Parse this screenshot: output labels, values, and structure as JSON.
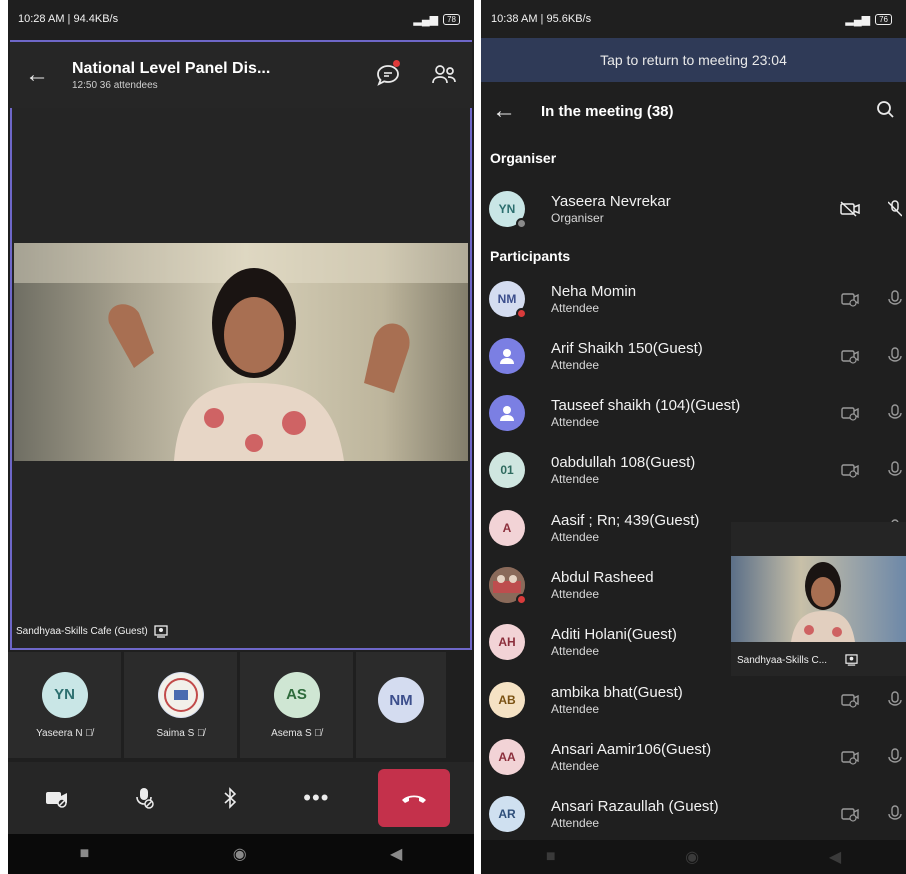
{
  "left": {
    "status": {
      "time_speed": "10:28 AM | 94.4KB/s",
      "battery": "78"
    },
    "header": {
      "title": "National Level Panel Dis...",
      "subtitle": "12:50  36 attendees"
    },
    "speaker_label": "Sandhyaa-Skills Cafe (Guest)",
    "tiles": [
      {
        "initials": "YN",
        "name": "Yaseera N",
        "bg": "#c9e6e6",
        "fg": "#2c6f6f"
      },
      {
        "initials": "",
        "name": "Saima S",
        "bg": "#d8dff0",
        "fg": "#7a3b3b"
      },
      {
        "initials": "AS",
        "name": "Asema S",
        "bg": "#cfe6d3",
        "fg": "#2f6b3c"
      },
      {
        "initials": "NM",
        "name": "",
        "bg": "#d4dcf0",
        "fg": "#3c4e8c"
      }
    ]
  },
  "right": {
    "status": {
      "time_speed": "10:38 AM | 95.6KB/s",
      "battery": "76"
    },
    "return_bar": "Tap to return to meeting 23:04",
    "header_title": "In the meeting (38)",
    "organiser_section": "Organiser",
    "participants_section": "Participants",
    "organiser": {
      "initials": "YN",
      "name": "Yaseera Nevrekar",
      "role": "Organiser",
      "bg": "#c9e6e6",
      "fg": "#2c6f6f"
    },
    "participants": [
      {
        "initials": "NM",
        "name": "Neha Momin",
        "role": "Attendee",
        "bg": "#d4dcf0",
        "fg": "#3c4e8c",
        "presence": "#d93b3b"
      },
      {
        "initials": "",
        "name": "Arif Shaikh 150(Guest)",
        "role": "Attendee",
        "bg": "#7b7fe3",
        "fg": "#ffffff",
        "icon": "person"
      },
      {
        "initials": "",
        "name": "Tauseef shaikh (104)(Guest)",
        "role": "Attendee",
        "bg": "#7b7fe3",
        "fg": "#ffffff",
        "icon": "person"
      },
      {
        "initials": "01",
        "name": "0abdullah 108(Guest)",
        "role": "Attendee",
        "bg": "#cfe6e0",
        "fg": "#2e6a5e"
      },
      {
        "initials": "A",
        "name": "Aasif ; Rn; 439(Guest)",
        "role": "Attendee",
        "bg": "#f2d3d6",
        "fg": "#8c2f3c"
      },
      {
        "initials": "",
        "name": "Abdul Rasheed",
        "role": "Attendee",
        "bg": "#7a5a4a",
        "fg": "#ffffff",
        "presence": "#d93b3b",
        "photo": true
      },
      {
        "initials": "AH",
        "name": "Aditi Holani(Guest)",
        "role": "Attendee",
        "bg": "#f2d3d6",
        "fg": "#8c2f3c"
      },
      {
        "initials": "AB",
        "name": "ambika bhat(Guest)",
        "role": "Attendee",
        "bg": "#f5e2c4",
        "fg": "#7a5213"
      },
      {
        "initials": "AA",
        "name": "Ansari Aamir106(Guest)",
        "role": "Attendee",
        "bg": "#f2d3d6",
        "fg": "#8c2f3c"
      },
      {
        "initials": "AR",
        "name": "Ansari Razaullah (Guest)",
        "role": "Attendee",
        "bg": "#cfe0f0",
        "fg": "#2f4f7a"
      }
    ],
    "pip_label": "Sandhyaa-Skills C..."
  }
}
